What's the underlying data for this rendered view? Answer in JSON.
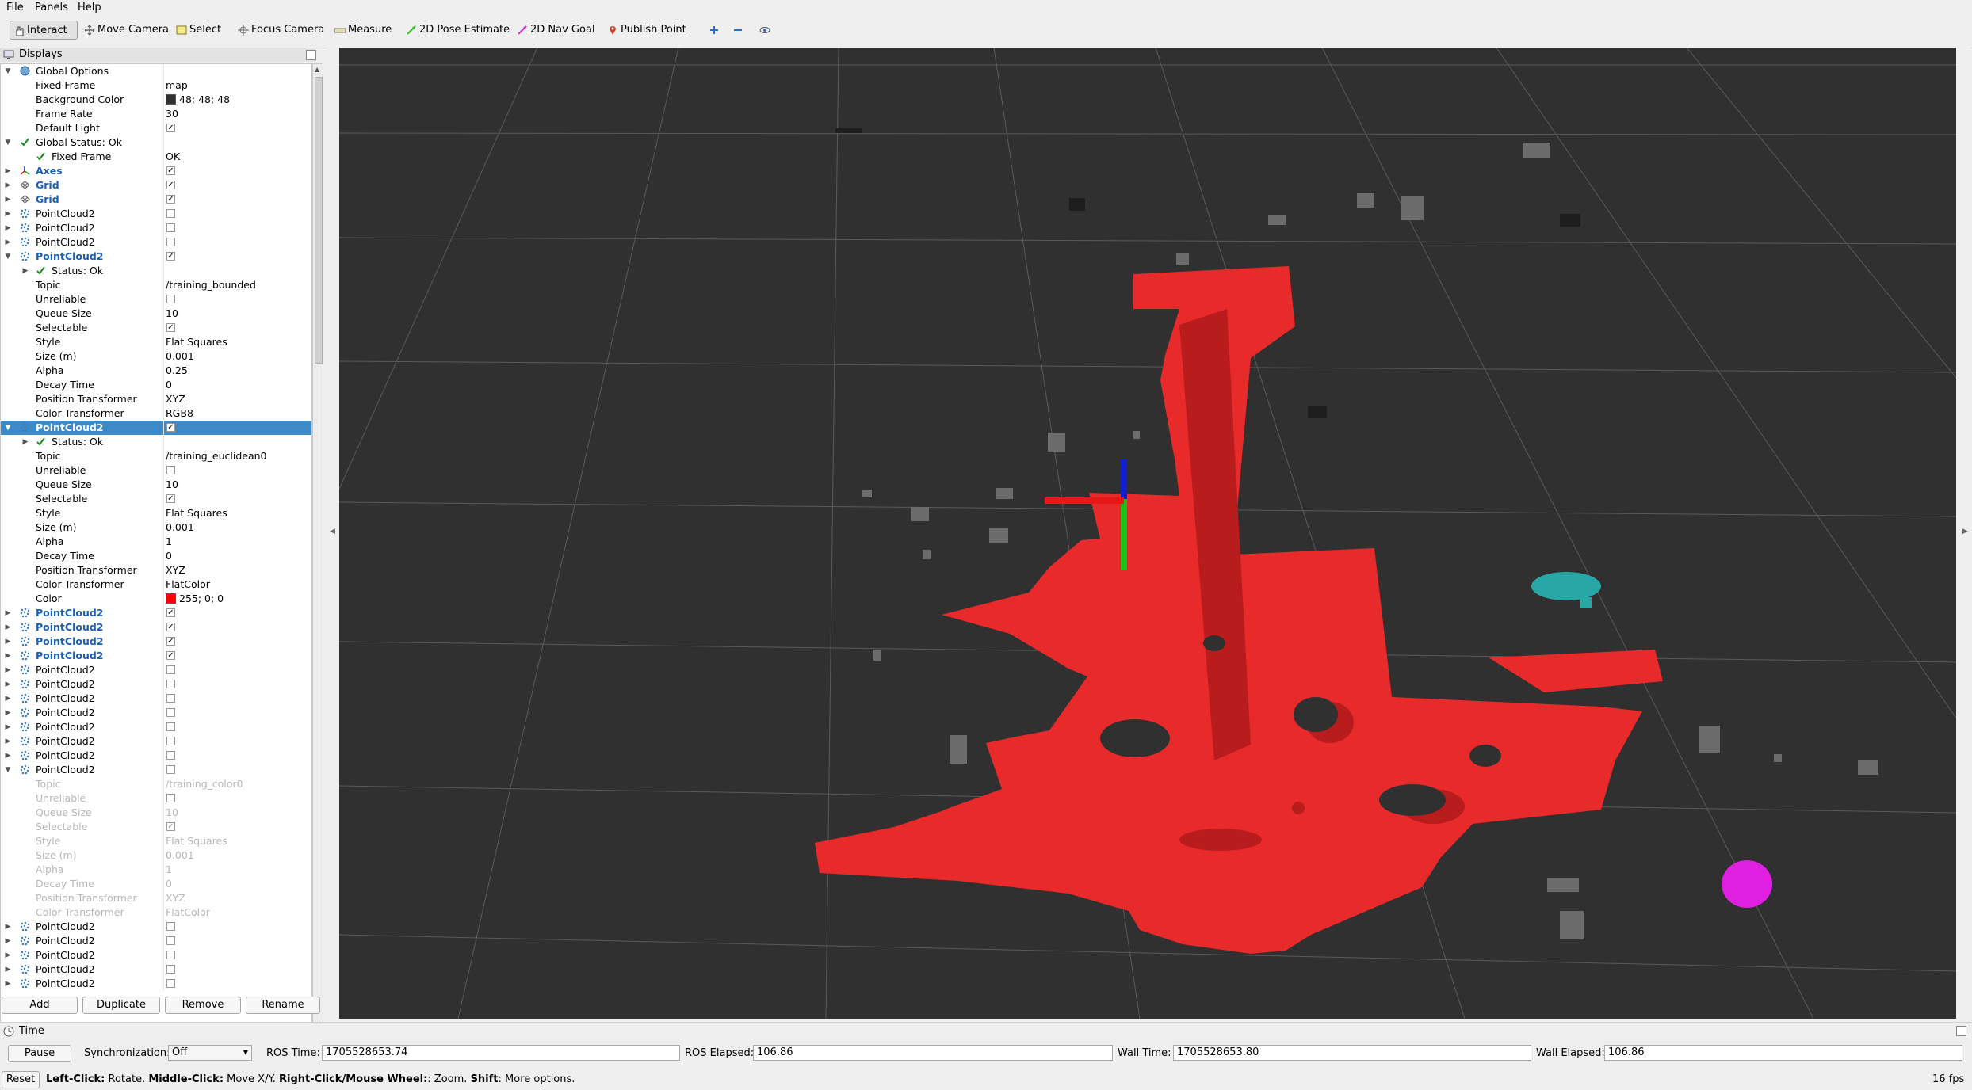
{
  "menu": [
    "File",
    "Panels",
    "Help"
  ],
  "toolbar": {
    "tools": [
      "Interact",
      "Move Camera",
      "Select",
      "Focus Camera",
      "Measure",
      "2D Pose Estimate",
      "2D Nav Goal",
      "Publish Point"
    ]
  },
  "displays": {
    "title": "Displays",
    "rows": [
      {
        "name": "Global Options",
        "value": "",
        "arrow": "open",
        "icon": "globe",
        "indent": 0
      },
      {
        "name": "Fixed Frame",
        "value": "map",
        "indent": 1
      },
      {
        "name": "Background Color",
        "value": "48; 48; 48",
        "swatch": "#303030",
        "indent": 1
      },
      {
        "name": "Frame Rate",
        "value": "30",
        "indent": 1
      },
      {
        "name": "Default Light",
        "check": true,
        "indent": 1
      },
      {
        "name": "Global Status: Ok",
        "arrow": "open",
        "icon": "check",
        "indent": 0
      },
      {
        "name": "Fixed Frame",
        "value": "OK",
        "icon": "check",
        "indent": 1
      },
      {
        "name": "Axes",
        "check": true,
        "bold": true,
        "arrow": "closed",
        "icon": "axes",
        "indent": 0
      },
      {
        "name": "Grid",
        "check": true,
        "bold": true,
        "arrow": "closed",
        "icon": "grid",
        "indent": 0
      },
      {
        "name": "Grid",
        "check": true,
        "bold": true,
        "arrow": "closed",
        "icon": "grid",
        "indent": 0
      },
      {
        "name": "PointCloud2",
        "check": false,
        "arrow": "closed",
        "icon": "pc",
        "indent": 0
      },
      {
        "name": "PointCloud2",
        "check": false,
        "arrow": "closed",
        "icon": "pc",
        "indent": 0
      },
      {
        "name": "PointCloud2",
        "check": false,
        "arrow": "closed",
        "icon": "pc",
        "indent": 0
      },
      {
        "name": "PointCloud2",
        "check": true,
        "bold": true,
        "arrow": "open",
        "icon": "pc",
        "indent": 0
      },
      {
        "name": "Status: Ok",
        "arrow": "closed",
        "icon": "check",
        "indent": 1
      },
      {
        "name": "Topic",
        "value": "/training_bounded",
        "indent": 1
      },
      {
        "name": "Unreliable",
        "check": false,
        "indent": 1
      },
      {
        "name": "Queue Size",
        "value": "10",
        "indent": 1
      },
      {
        "name": "Selectable",
        "check": true,
        "indent": 1
      },
      {
        "name": "Style",
        "value": "Flat Squares",
        "indent": 1
      },
      {
        "name": "Size (m)",
        "value": "0.001",
        "indent": 1
      },
      {
        "name": "Alpha",
        "value": "0.25",
        "indent": 1
      },
      {
        "name": "Decay Time",
        "value": "0",
        "indent": 1
      },
      {
        "name": "Position Transformer",
        "value": "XYZ",
        "indent": 1
      },
      {
        "name": "Color Transformer",
        "value": "RGB8",
        "indent": 1
      },
      {
        "name": "PointCloud2",
        "check": true,
        "bold": true,
        "arrow": "open",
        "icon": "pc",
        "indent": 0,
        "selected": true
      },
      {
        "name": "Status: Ok",
        "arrow": "closed",
        "icon": "check",
        "indent": 1
      },
      {
        "name": "Topic",
        "value": "/training_euclidean0",
        "indent": 1
      },
      {
        "name": "Unreliable",
        "check": false,
        "indent": 1
      },
      {
        "name": "Queue Size",
        "value": "10",
        "indent": 1
      },
      {
        "name": "Selectable",
        "check": true,
        "indent": 1
      },
      {
        "name": "Style",
        "value": "Flat Squares",
        "indent": 1
      },
      {
        "name": "Size (m)",
        "value": "0.001",
        "indent": 1
      },
      {
        "name": "Alpha",
        "value": "1",
        "indent": 1
      },
      {
        "name": "Decay Time",
        "value": "0",
        "indent": 1
      },
      {
        "name": "Position Transformer",
        "value": "XYZ",
        "indent": 1
      },
      {
        "name": "Color Transformer",
        "value": "FlatColor",
        "indent": 1
      },
      {
        "name": "Color",
        "value": "255; 0; 0",
        "swatch": "#ff0000",
        "indent": 1
      },
      {
        "name": "PointCloud2",
        "check": true,
        "bold": true,
        "arrow": "closed",
        "icon": "pc",
        "indent": 0
      },
      {
        "name": "PointCloud2",
        "check": true,
        "bold": true,
        "arrow": "closed",
        "icon": "pc",
        "indent": 0
      },
      {
        "name": "PointCloud2",
        "check": true,
        "bold": true,
        "arrow": "closed",
        "icon": "pc",
        "indent": 0
      },
      {
        "name": "PointCloud2",
        "check": true,
        "bold": true,
        "arrow": "closed",
        "icon": "pc",
        "indent": 0
      },
      {
        "name": "PointCloud2",
        "check": false,
        "arrow": "closed",
        "icon": "pc",
        "indent": 0
      },
      {
        "name": "PointCloud2",
        "check": false,
        "arrow": "closed",
        "icon": "pc",
        "indent": 0
      },
      {
        "name": "PointCloud2",
        "check": false,
        "arrow": "closed",
        "icon": "pc",
        "indent": 0
      },
      {
        "name": "PointCloud2",
        "check": false,
        "arrow": "closed",
        "icon": "pc",
        "indent": 0
      },
      {
        "name": "PointCloud2",
        "check": false,
        "arrow": "closed",
        "icon": "pc",
        "indent": 0
      },
      {
        "name": "PointCloud2",
        "check": false,
        "arrow": "closed",
        "icon": "pc",
        "indent": 0
      },
      {
        "name": "PointCloud2",
        "check": false,
        "arrow": "closed",
        "icon": "pc",
        "indent": 0
      },
      {
        "name": "PointCloud2",
        "check": false,
        "arrow": "open",
        "icon": "pc",
        "indent": 0
      },
      {
        "name": "Topic",
        "value": "/training_color0",
        "indent": 1,
        "disabled": true
      },
      {
        "name": "Unreliable",
        "check": false,
        "indent": 1,
        "disabled": true
      },
      {
        "name": "Queue Size",
        "value": "10",
        "indent": 1,
        "disabled": true
      },
      {
        "name": "Selectable",
        "check": true,
        "indent": 1,
        "disabled": true
      },
      {
        "name": "Style",
        "value": "Flat Squares",
        "indent": 1,
        "disabled": true
      },
      {
        "name": "Size (m)",
        "value": "0.001",
        "indent": 1,
        "disabled": true
      },
      {
        "name": "Alpha",
        "value": "1",
        "indent": 1,
        "disabled": true
      },
      {
        "name": "Decay Time",
        "value": "0",
        "indent": 1,
        "disabled": true
      },
      {
        "name": "Position Transformer",
        "value": "XYZ",
        "indent": 1,
        "disabled": true
      },
      {
        "name": "Color Transformer",
        "value": "FlatColor",
        "indent": 1,
        "disabled": true
      },
      {
        "name": "PointCloud2",
        "check": false,
        "arrow": "closed",
        "icon": "pc",
        "indent": 0
      },
      {
        "name": "PointCloud2",
        "check": false,
        "arrow": "closed",
        "icon": "pc",
        "indent": 0
      },
      {
        "name": "PointCloud2",
        "check": false,
        "arrow": "closed",
        "icon": "pc",
        "indent": 0
      },
      {
        "name": "PointCloud2",
        "check": false,
        "arrow": "closed",
        "icon": "pc",
        "indent": 0
      },
      {
        "name": "PointCloud2",
        "check": false,
        "arrow": "closed",
        "icon": "pc",
        "indent": 0
      }
    ],
    "buttons": {
      "add": "Add",
      "duplicate": "Duplicate",
      "remove": "Remove",
      "rename": "Rename"
    }
  },
  "time": {
    "title": "Time",
    "pause": "Pause",
    "sync_label": "Synchronization:",
    "sync_value": "Off",
    "ros_time_label": "ROS Time:",
    "ros_time": "1705528653.74",
    "ros_elapsed_label": "ROS Elapsed:",
    "ros_elapsed": "106.86",
    "wall_time_label": "Wall Time:",
    "wall_time": "1705528653.80",
    "wall_elapsed_label": "Wall Elapsed:",
    "wall_elapsed": "106.86"
  },
  "status": {
    "reset": "Reset",
    "hint_1_bold": "Left-Click:",
    "hint_1": " Rotate. ",
    "hint_2_bold": "Middle-Click:",
    "hint_2": " Move X/Y. ",
    "hint_3_bold": "Right-Click/Mouse Wheel:",
    "hint_3": ": Zoom. ",
    "hint_4_bold": "Shift",
    "hint_4": ": More options.",
    "fps": "16 fps"
  },
  "colors": {
    "background": "#303030",
    "selected_cloud": "#ff2020",
    "cyan_cluster": "#29a7a7",
    "magenta_cluster": "#e020e0",
    "selection": "#3d8ac8"
  }
}
